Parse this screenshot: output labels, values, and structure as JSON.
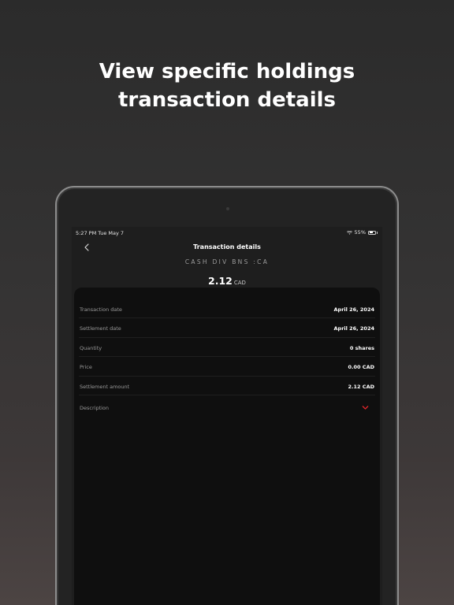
{
  "headline": {
    "line1": "View specific holdings",
    "line2": "transaction details"
  },
  "status_bar": {
    "time_date": "5:27 PM   Tue May 7",
    "battery": "55%"
  },
  "nav": {
    "title": "Transaction details",
    "back_icon": "chevron-left-icon"
  },
  "transaction": {
    "symbol": "CASH DIV BNS :CA",
    "amount": "2.12",
    "currency": "CAD"
  },
  "details": [
    {
      "label": "Transaction date",
      "value": "April 26, 2024"
    },
    {
      "label": "Settlement date",
      "value": "April 26, 2024"
    },
    {
      "label": "Quantity",
      "value": "0 shares"
    },
    {
      "label": "Price",
      "value": "0.00 CAD"
    },
    {
      "label": "Settlement amount",
      "value": "2.12 CAD"
    }
  ],
  "description": {
    "label": "Description",
    "icon": "chevron-down-icon"
  },
  "colors": {
    "accent": "#e8262b",
    "background": "#0f0f0f"
  }
}
